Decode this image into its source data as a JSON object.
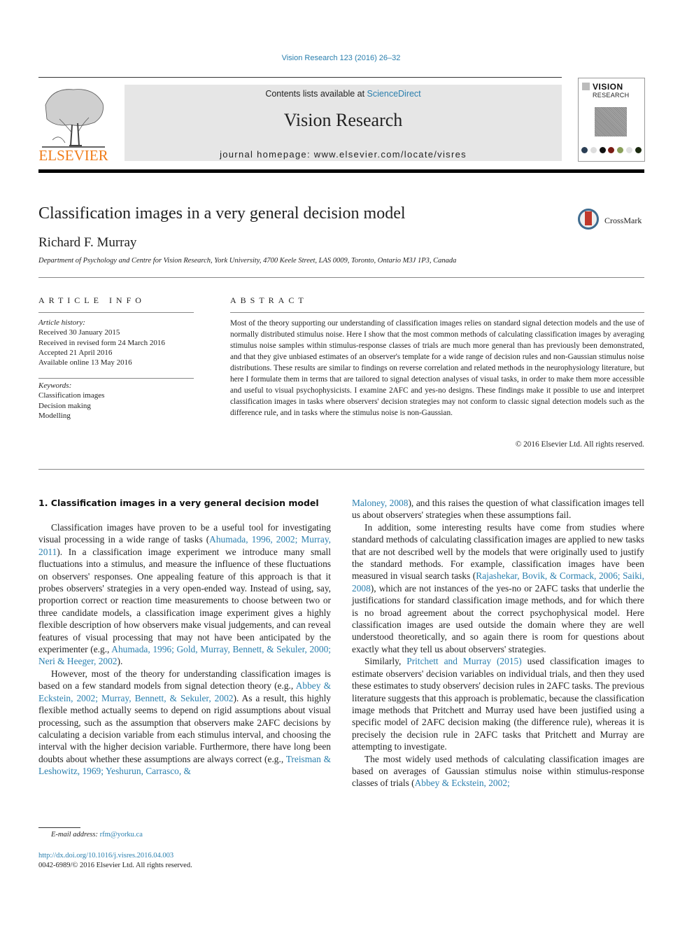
{
  "journal_ref": "Vision Research 123 (2016) 26–32",
  "header": {
    "publisher_logo_text": "ELSEVIER",
    "contents_prefix": "Contents lists available at ",
    "contents_link": "ScienceDirect",
    "journal_name": "Vision Research",
    "homepage_prefix": "journal homepage: ",
    "homepage_url": "www.elsevier.com/locate/visres",
    "cover_title": "VISION",
    "cover_subtitle": "RESEARCH"
  },
  "colors": {
    "link": "#2a7fae",
    "elsevier_orange": "#f07d1a",
    "header_band": "#e6e6e6"
  },
  "article": {
    "title": "Classification images in a very general decision model",
    "crossmark_label": "CrossMark",
    "author": "Richard F. Murray",
    "affiliation": "Department of Psychology and Centre for Vision Research, York University, 4700 Keele Street, LAS 0009, Toronto, Ontario M3J 1P3, Canada"
  },
  "article_info": {
    "heading": "ARTICLE INFO",
    "history_label": "Article history:",
    "history": [
      "Received 30 January 2015",
      "Received in revised form 24 March 2016",
      "Accepted 21 April 2016",
      "Available online 13 May 2016"
    ],
    "keywords_label": "Keywords:",
    "keywords": [
      "Classification images",
      "Decision making",
      "Modelling"
    ]
  },
  "abstract": {
    "heading": "ABSTRACT",
    "text": "Most of the theory supporting our understanding of classification images relies on standard signal detection models and the use of normally distributed stimulus noise. Here I show that the most common methods of calculating classification images by averaging stimulus noise samples within stimulus-response classes of trials are much more general than has previously been demonstrated, and that they give unbiased estimates of an observer's template for a wide range of decision rules and non-Gaussian stimulus noise distributions. These results are similar to findings on reverse correlation and related methods in the neurophysiology literature, but here I formulate them in terms that are tailored to signal detection analyses of visual tasks, in order to make them more accessible and useful to visual psychophysicists. I examine 2AFC and yes-no designs. These findings make it possible to use and interpret classification images in tasks where observers' decision strategies may not conform to classic signal detection models such as the difference rule, and in tasks where the stimulus noise is non-Gaussian.",
    "copyright": "© 2016 Elsevier Ltd. All rights reserved."
  },
  "body": {
    "section_heading": "1. Classification images in a very general decision model",
    "left": {
      "p1_a": "Classification images have proven to be a useful tool for investigating visual processing in a wide range of tasks (",
      "p1_cite1": "Ahumada, 1996, 2002; Murray, 2011",
      "p1_b": "). In a classification image experiment we introduce many small fluctuations into a stimulus, and measure the influence of these fluctuations on observers' responses. One appealing feature of this approach is that it probes observers' strategies in a very open-ended way. Instead of using, say, proportion correct or reaction time measurements to choose between two or three candidate models, a classification image experiment gives a highly flexible description of how observers make visual judgements, and can reveal features of visual processing that may not have been anticipated by the experimenter (e.g., ",
      "p1_cite2": "Ahumada, 1996; Gold, Murray, Bennett, & Sekuler, 2000; Neri & Heeger, 2002",
      "p1_c": ").",
      "p2_a": "However, most of the theory for understanding classification images is based on a few standard models from signal detection theory (e.g., ",
      "p2_cite1": "Abbey & Eckstein, 2002; Murray, Bennett, & Sekuler, 2002",
      "p2_b": "). As a result, this highly flexible method actually seems to depend on rigid assumptions about visual processing, such as the assumption that observers make 2AFC decisions by calculating a decision variable from each stimulus interval, and choosing the interval with the higher decision variable. Furthermore, there have long been doubts about whether these assumptions are always correct (e.g., ",
      "p2_cite2": "Treisman & Leshowitz, 1969; Yeshurun, Carrasco, &"
    },
    "right": {
      "p2_cite2_cont": "Maloney, 2008",
      "p2_c": "), and this raises the question of what classification images tell us about observers' strategies when these assumptions fail.",
      "p3_a": "In addition, some interesting results have come from studies where standard methods of calculating classification images are applied to new tasks that are not described well by the models that were originally used to justify the standard methods. For example, classification images have been measured in visual search tasks (",
      "p3_cite1": "Rajashekar, Bovik, & Cormack, 2006; Saiki, 2008",
      "p3_b": "), which are not instances of the yes-no or 2AFC tasks that underlie the justifications for standard classification image methods, and for which there is no broad agreement about the correct psychophysical model. Here classification images are used outside the domain where they are well understood theoretically, and so again there is room for questions about exactly what they tell us about observers' strategies.",
      "p4_a": "Similarly, ",
      "p4_cite1": "Pritchett and Murray (2015)",
      "p4_b": " used classification images to estimate observers' decision variables on individual trials, and then they used these estimates to study observers' decision rules in 2AFC tasks. The previous literature suggests that this approach is problematic, because the classification image methods that Pritchett and Murray used have been justified using a specific model of 2AFC decision making (the difference rule), whereas it is precisely the decision rule in 2AFC tasks that Pritchett and Murray are attempting to investigate.",
      "p5_a": "The most widely used methods of calculating classification images are based on averages of Gaussian stimulus noise within stimulus-response classes of trials (",
      "p5_cite1": "Abbey & Eckstein, 2002;"
    }
  },
  "footer": {
    "email_label": "E-mail address: ",
    "email": "rfm@yorku.ca",
    "doi": "http://dx.doi.org/10.1016/j.visres.2016.04.003",
    "issn": "0042-6989/© 2016 Elsevier Ltd. All rights reserved."
  }
}
